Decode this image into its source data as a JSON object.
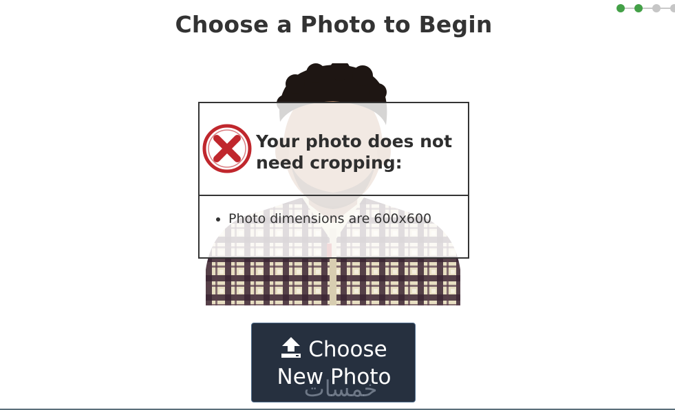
{
  "page": {
    "title": "Choose a Photo to Begin"
  },
  "stepper": {
    "steps": [
      "done",
      "done",
      "todo",
      "todo"
    ]
  },
  "photo": {
    "description_icon": "portrait-photo"
  },
  "error_panel": {
    "icon": "x-circle-icon",
    "icon_color": "#c0272d",
    "message": "Your photo does not need cropping:",
    "details": [
      "Photo dimensions are 600x600"
    ]
  },
  "choose_button": {
    "icon": "upload-icon",
    "label_line1": "Choose",
    "label_line2": "New Photo",
    "background": "#26303f"
  },
  "watermark": {
    "text": "خمسات"
  }
}
